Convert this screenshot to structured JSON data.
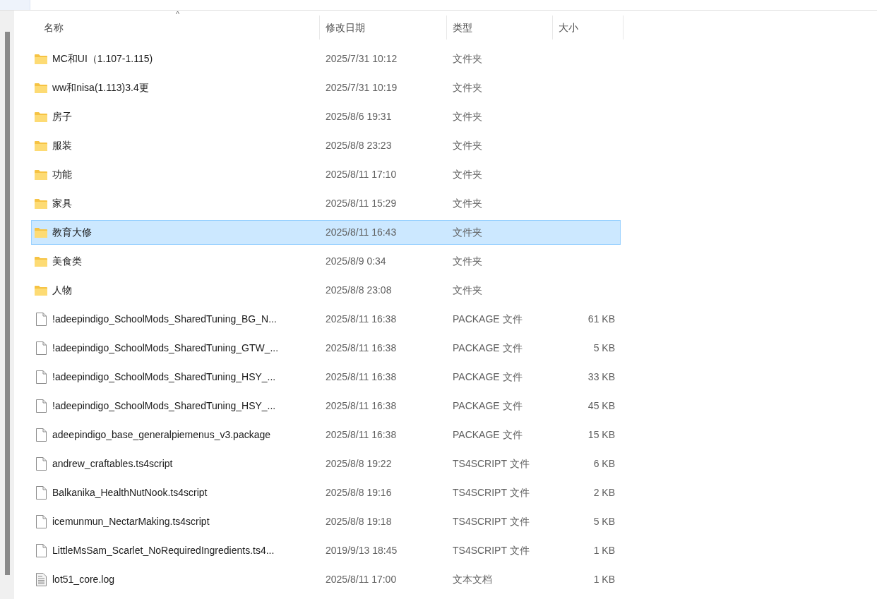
{
  "columns": [
    "名称",
    "修改日期",
    "类型",
    "大小"
  ],
  "sort_indicator": "^",
  "rows": [
    {
      "kind": "folder",
      "name": "MC和UI（1.107-1.115)",
      "date": "2025/7/31 10:12",
      "type": "文件夹",
      "selected": false
    },
    {
      "kind": "folder",
      "name": "ww和nisa(1.113)3.4更",
      "date": "2025/7/31 10:19",
      "type": "文件夹",
      "selected": false
    },
    {
      "kind": "folder",
      "name": "房子",
      "date": "2025/8/6 19:31",
      "type": "文件夹",
      "selected": false
    },
    {
      "kind": "folder",
      "name": "服装",
      "date": "2025/8/8 23:23",
      "type": "文件夹",
      "selected": false
    },
    {
      "kind": "folder",
      "name": "功能",
      "date": "2025/8/11 17:10",
      "type": "文件夹",
      "selected": false
    },
    {
      "kind": "folder",
      "name": "家具",
      "date": "2025/8/11 15:29",
      "type": "文件夹",
      "selected": false
    },
    {
      "kind": "folder",
      "name": "教育大修",
      "date": "2025/8/11 16:43",
      "type": "文件夹",
      "selected": true
    },
    {
      "kind": "folder",
      "name": "美食类",
      "date": "2025/8/9 0:34",
      "type": "文件夹",
      "selected": false
    },
    {
      "kind": "folder",
      "name": "人物",
      "date": "2025/8/8 23:08",
      "type": "文件夹",
      "selected": false
    },
    {
      "kind": "file",
      "name": "!adeepindigo_SchoolMods_SharedTuning_BG_N...",
      "date": "2025/8/11 16:38",
      "type": "PACKAGE 文件",
      "size": "61 KB",
      "selected": false
    },
    {
      "kind": "file",
      "name": "!adeepindigo_SchoolMods_SharedTuning_GTW_...",
      "date": "2025/8/11 16:38",
      "type": "PACKAGE 文件",
      "size": "5 KB",
      "selected": false
    },
    {
      "kind": "file",
      "name": "!adeepindigo_SchoolMods_SharedTuning_HSY_...",
      "date": "2025/8/11 16:38",
      "type": "PACKAGE 文件",
      "size": "33 KB",
      "selected": false
    },
    {
      "kind": "file",
      "name": "!adeepindigo_SchoolMods_SharedTuning_HSY_...",
      "date": "2025/8/11 16:38",
      "type": "PACKAGE 文件",
      "size": "45 KB",
      "selected": false
    },
    {
      "kind": "file",
      "name": "adeepindigo_base_generalpiemenus_v3.package",
      "date": "2025/8/11 16:38",
      "type": "PACKAGE 文件",
      "size": "15 KB",
      "selected": false
    },
    {
      "kind": "file",
      "name": "andrew_craftables.ts4script",
      "date": "2025/8/8 19:22",
      "type": "TS4SCRIPT 文件",
      "size": "6 KB",
      "selected": false
    },
    {
      "kind": "file",
      "name": "Balkanika_HealthNutNook.ts4script",
      "date": "2025/8/8 19:16",
      "type": "TS4SCRIPT 文件",
      "size": "2 KB",
      "selected": false
    },
    {
      "kind": "file",
      "name": "icemunmun_NectarMaking.ts4script",
      "date": "2025/8/8 19:18",
      "type": "TS4SCRIPT 文件",
      "size": "5 KB",
      "selected": false
    },
    {
      "kind": "file",
      "name": "LittleMsSam_Scarlet_NoRequiredIngredients.ts4...",
      "date": "2019/9/13 18:45",
      "type": "TS4SCRIPT 文件",
      "size": "1 KB",
      "selected": false
    },
    {
      "kind": "text",
      "name": "lot51_core.log",
      "date": "2025/8/11 17:00",
      "type": "文本文档",
      "size": "1 KB",
      "selected": false
    }
  ]
}
